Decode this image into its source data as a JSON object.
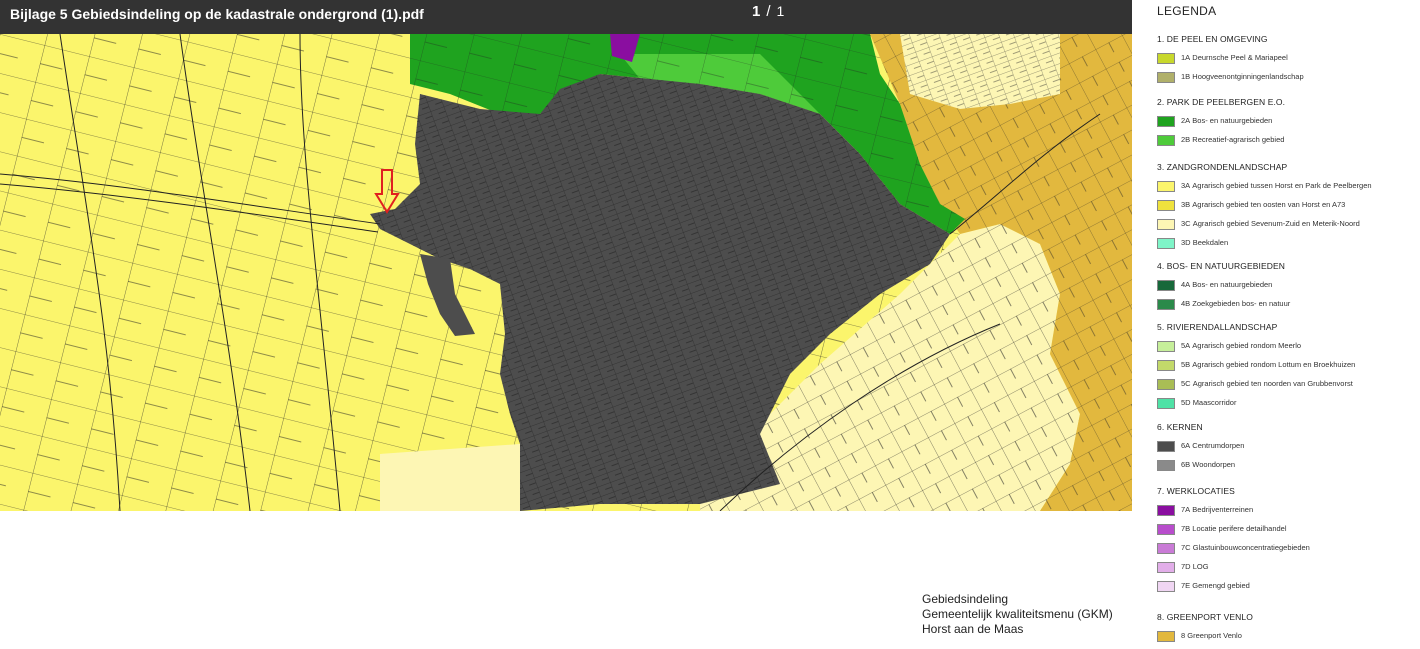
{
  "viewer": {
    "filename": "Bijlage 5 Gebiedsindeling op de kadastrale ondergrond (1).pdf",
    "current_page": "1",
    "page_separator": "/",
    "total_pages": "1"
  },
  "legend": {
    "title": "LEGENDA",
    "sections": [
      {
        "title": "1. DE PEEL EN OMGEVING",
        "items": [
          {
            "code": "1A",
            "label": "Deurnsche Peel & Mariapeel",
            "color": "#c8d82c"
          },
          {
            "code": "1B",
            "label": "Hoogveenontginningenlandschap",
            "color": "#b0b06a"
          }
        ]
      },
      {
        "title": "2. PARK DE PEELBERGEN E.O.",
        "items": [
          {
            "code": "2A",
            "label": "Bos- en natuurgebieden",
            "color": "#1fa31f"
          },
          {
            "code": "2B",
            "label": "Recreatief-agrarisch gebied",
            "color": "#4ecb3a"
          }
        ]
      },
      {
        "title": "3. ZANDGRONDENLANDSCHAP",
        "items": [
          {
            "code": "3A",
            "label": "Agrarisch gebied tussen Horst en Park de Peelbergen",
            "color": "#fbf56c"
          },
          {
            "code": "3B",
            "label": "Agrarisch gebied ten oosten van Horst en A73",
            "color": "#efe23d"
          },
          {
            "code": "3C",
            "label": "Agrarisch gebied Sevenum-Zuid en Meterik-Noord",
            "color": "#fdf6b4"
          },
          {
            "code": "3D",
            "label": "Beekdalen",
            "color": "#7ff5c8"
          }
        ]
      },
      {
        "title": "4. BOS- EN NATUURGEBIEDEN",
        "items": [
          {
            "code": "4A",
            "label": "Bos- en natuurgebieden",
            "color": "#17683a"
          },
          {
            "code": "4B",
            "label": "Zoekgebieden bos- en natuur",
            "color": "#2b8a4a"
          }
        ]
      },
      {
        "title": "5. RIVIERENDALLANDSCHAP",
        "items": [
          {
            "code": "5A",
            "label": "Agrarisch gebied rondom Meerlo",
            "color": "#c6ef9a"
          },
          {
            "code": "5B",
            "label": "Agrarisch gebied rondom Lottum en Broekhuizen",
            "color": "#c3d96a"
          },
          {
            "code": "5C",
            "label": "Agrarisch gebied ten noorden van Grubbenvorst",
            "color": "#a9bd55"
          },
          {
            "code": "5D",
            "label": "Maascorridor",
            "color": "#4fe2a6"
          }
        ]
      },
      {
        "title": "6. KERNEN",
        "items": [
          {
            "code": "6A",
            "label": "Centrumdorpen",
            "color": "#4d4d4d"
          },
          {
            "code": "6B",
            "label": "Woondorpen",
            "color": "#8a8a8a"
          }
        ]
      },
      {
        "title": "7. WERKLOCATIES",
        "items": [
          {
            "code": "7A",
            "label": "Bedrijventerreinen",
            "color": "#8a0ea0"
          },
          {
            "code": "7B",
            "label": "Locatie perifere detailhandel",
            "color": "#b84dcc"
          },
          {
            "code": "7C",
            "label": "Glastuinbouwconcentratiegebieden",
            "color": "#c97bd6"
          },
          {
            "code": "7D",
            "label": "LOG",
            "color": "#e2aee9"
          },
          {
            "code": "7E",
            "label": "Gemengd gebied",
            "color": "#f0d6f3"
          }
        ]
      },
      {
        "title": "8. GREENPORT VENLO",
        "items": [
          {
            "code": "8",
            "label": "Greenport Venlo",
            "color": "#e2b83e"
          }
        ]
      }
    ]
  },
  "caption": {
    "line1": "Gebiedsindeling",
    "line2": "Gemeentelijk kwaliteitsmenu (GKM)",
    "line3": "Horst aan de Maas"
  },
  "map_colors": {
    "zandgrond_3a": "#fbf56c",
    "zandgrond_3c": "#fdf6b4",
    "peelbergen_2a": "#1fa31f",
    "peelbergen_2b": "#4ecb3a",
    "kern_6a": "#4d4d4d",
    "greenport_8": "#e2b83e",
    "werklocatie_7a": "#8a0ea0",
    "marker": "#e02020"
  }
}
